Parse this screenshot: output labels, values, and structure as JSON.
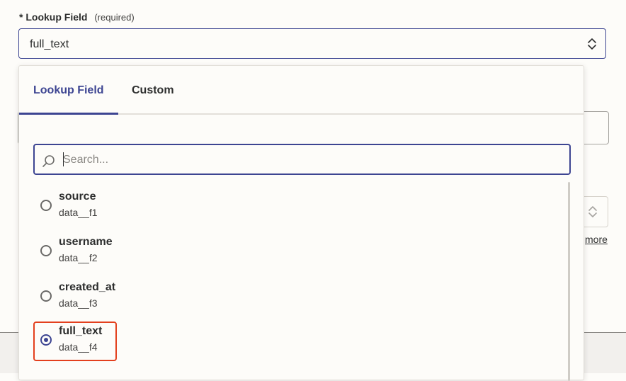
{
  "field": {
    "asterisk": "*",
    "label": "Lookup Field",
    "required_note": "(required)",
    "selected_value": "full_text"
  },
  "background": {
    "more_link": "more"
  },
  "dropdown": {
    "tabs": [
      {
        "label": "Lookup Field",
        "active": true
      },
      {
        "label": "Custom",
        "active": false
      }
    ],
    "search": {
      "placeholder": "Search...",
      "value": ""
    },
    "options": [
      {
        "name": "source",
        "key": "data__f1",
        "selected": false
      },
      {
        "name": "username",
        "key": "data__f2",
        "selected": false
      },
      {
        "name": "created_at",
        "key": "data__f3",
        "selected": false
      },
      {
        "name": "full_text",
        "key": "data__f4",
        "selected": true
      }
    ]
  },
  "colors": {
    "accent": "#3d4592",
    "highlight": "#e3401e",
    "background": "#fdfcf9"
  },
  "icons": {
    "search": "magnifier-icon",
    "select": "up-down-chevron-icon"
  }
}
